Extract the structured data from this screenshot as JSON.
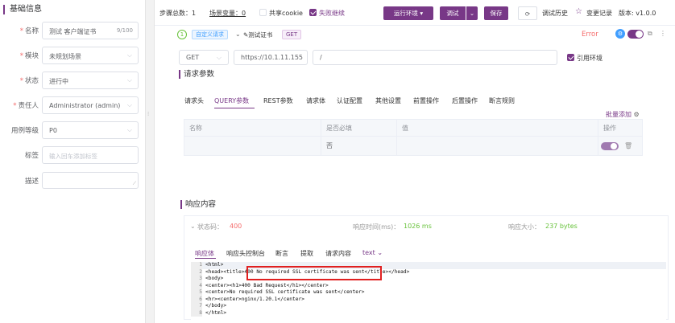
{
  "left_panel": {
    "title": "基础信息",
    "name": {
      "label": "名称",
      "value": "测试 客户端证书",
      "count": "9/100"
    },
    "module": {
      "label": "模块",
      "value": "未规划场景"
    },
    "status": {
      "label": "状态",
      "value": "进行中"
    },
    "owner": {
      "label": "责任人",
      "value": "Administrator (admin)"
    },
    "level": {
      "label": "用例等级",
      "value": "P0"
    },
    "tags": {
      "label": "标签",
      "placeholder": "输入回车添加标签"
    },
    "desc": {
      "label": "描述",
      "value": ""
    }
  },
  "toolbar": {
    "steps_total": "步骤总数：1",
    "scene_vars": "场景变量：0",
    "share_cookie": "共享cookie",
    "fail_stop": "失败继续",
    "run_env": "运行环境",
    "debug": "调试",
    "save": "保存",
    "debug_history": "调试历史",
    "change_log": "变更记录",
    "version": "版本: v1.0.0"
  },
  "step": {
    "index": "1",
    "type_tag": "自定义请求",
    "name": "测试证书",
    "method_tag": "GET",
    "error_label": "Error"
  },
  "url_row": {
    "method": "GET",
    "host": "https://10.1.11.155",
    "path": "/",
    "use_env": "引用环境"
  },
  "request_params": {
    "title": "请求参数",
    "tabs": [
      "请求头",
      "QUERY参数",
      "REST参数",
      "请求体",
      "认证配置",
      "其他设置",
      "前置操作",
      "后置操作",
      "断言规则"
    ],
    "active_tab": "QUERY参数",
    "batch_add": "批量添加",
    "columns": [
      "名称",
      "是否必填",
      "值",
      "操作"
    ],
    "row": {
      "name": "",
      "required": "否",
      "value": ""
    }
  },
  "response": {
    "title": "响应内容",
    "status_label": "状态码：",
    "status_value": "400",
    "time_label": "响应时间(ms)：",
    "time_value": "1026 ms",
    "size_label": "响应大小：",
    "size_value": "237 bytes",
    "tabs": [
      "响应体",
      "响应头",
      "控制台",
      "断言",
      "提取",
      "请求内容"
    ],
    "active_tab": "响应体",
    "format": "text",
    "code_lines": [
      "<html>",
      "<head><title>400 No required SSL certificate was sent</title></head>",
      "<body>",
      "<center><h1>400 Bad Request</h1></center>",
      "<center>No required SSL certificate was sent</center>",
      "<hr><center>nginx/1.20.1</center>",
      "</body>",
      "</html>"
    ],
    "line_numbers": [
      "1",
      "2",
      "3",
      "4",
      "5",
      "6",
      "7",
      "8"
    ]
  },
  "colors": {
    "primary": "#783887",
    "error": "#f56c6c",
    "success": "#67c23a",
    "highlight_box": "#e02020"
  }
}
